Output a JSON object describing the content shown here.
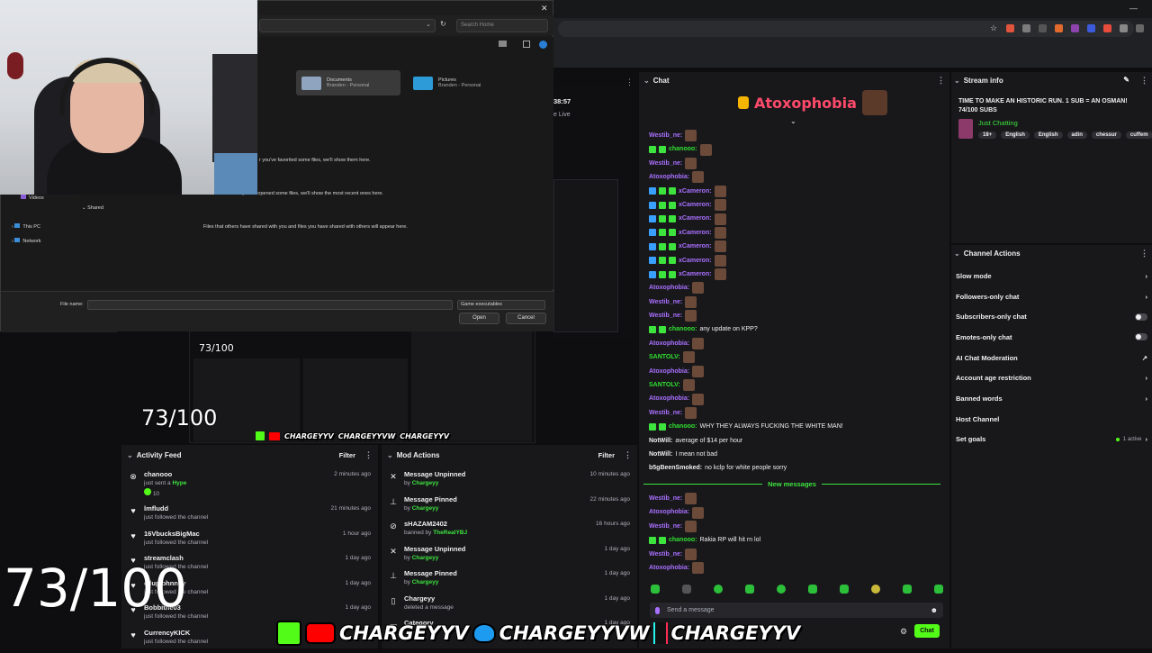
{
  "file_dialog": {
    "search_placeholder": "Search Home",
    "quick_access": [
      {
        "name": "Documents",
        "sub": "Branden - Personal"
      },
      {
        "name": "Pictures",
        "sub": "Branden - Personal"
      }
    ],
    "fav_msg": "r you've favorited some files, we'll show them here.",
    "recent_msg": "After you've opened some files, we'll show the most recent ones here.",
    "shared_msg": "Files that others have shared with you and files you have shared with others will appear here.",
    "shared_label": "Shared",
    "nav": [
      "Videos",
      "This PC",
      "Network"
    ],
    "file_name_label": "File name:",
    "file_type": "Game executables",
    "open": "Open",
    "cancel": "Cancel"
  },
  "stream_preview": {
    "time": "38:57",
    "status": "e Live"
  },
  "overlay": {
    "count_small": "73/100",
    "count_medium": "73/100",
    "count_large": "73/100",
    "socials": [
      "CHARGEYYV",
      "CHARGEYYVW",
      "CHARGEYYV"
    ]
  },
  "activity_feed": {
    "title": "Activity Feed",
    "filter": "Filter",
    "items": [
      {
        "name": "chanooo",
        "sub": "just sent a",
        "extra": "Hype",
        "amount": "10",
        "time": "2 minutes ago"
      },
      {
        "name": "lmfludd",
        "sub": "just followed the channel",
        "time": "21 minutes ago"
      },
      {
        "name": "16VbucksBigMac",
        "sub": "just followed the channel",
        "time": "1 hour ago"
      },
      {
        "name": "streamclash",
        "sub": "just followed the channel",
        "time": "1 day ago"
      },
      {
        "name": "ellupjohnnyy",
        "sub": "just followed the channel",
        "time": "1 day ago"
      },
      {
        "name": "Bobbithe03",
        "sub": "just followed the channel",
        "time": "1 day ago"
      },
      {
        "name": "CurrencyKICK",
        "sub": "just followed the channel",
        "time": ""
      }
    ]
  },
  "mod_actions": {
    "title": "Mod Actions",
    "filter": "Filter",
    "items": [
      {
        "title": "Message Unpinned",
        "by": "by",
        "user": "Chargeyy",
        "time": "10 minutes ago"
      },
      {
        "title": "Message Pinned",
        "by": "by",
        "user": "Chargeyy",
        "time": "22 minutes ago"
      },
      {
        "title": "sHAZAM2402",
        "by": "banned by",
        "user": "TheRealYBJ",
        "time": "16 hours ago"
      },
      {
        "title": "Message Unpinned",
        "by": "by",
        "user": "Chargeyy",
        "time": "1 day ago"
      },
      {
        "title": "Message Pinned",
        "by": "by",
        "user": "Chargeyy",
        "time": "1 day ago"
      },
      {
        "title": "Chargeyy",
        "by": "deleted a message",
        "user": "",
        "time": "1 day ago"
      },
      {
        "title": "Category",
        "by": "",
        "user": "",
        "time": "1 day ago"
      }
    ]
  },
  "chat": {
    "title": "Chat",
    "pinned_user": "Atoxophobia",
    "new_messages": "New messages",
    "input_placeholder": "Send a message",
    "send": "Chat",
    "lines": [
      {
        "user": "Westib_ne:",
        "color": "purple",
        "msg": ""
      },
      {
        "user": "chanooo:",
        "color": "green",
        "msg": ""
      },
      {
        "user": "Westib_ne:",
        "color": "purple",
        "msg": ""
      },
      {
        "user": "Atoxophobia:",
        "color": "purple",
        "msg": ""
      },
      {
        "user": "xCameron:",
        "color": "purple",
        "msg": ""
      },
      {
        "user": "xCameron:",
        "color": "purple",
        "msg": ""
      },
      {
        "user": "xCameron:",
        "color": "purple",
        "msg": ""
      },
      {
        "user": "xCameron:",
        "color": "purple",
        "msg": ""
      },
      {
        "user": "xCameron:",
        "color": "purple",
        "msg": ""
      },
      {
        "user": "xCameron:",
        "color": "purple",
        "msg": ""
      },
      {
        "user": "xCameron:",
        "color": "purple",
        "msg": ""
      },
      {
        "user": "Atoxophobia:",
        "color": "purple",
        "msg": ""
      },
      {
        "user": "Westib_ne:",
        "color": "purple",
        "msg": ""
      },
      {
        "user": "Westib_ne:",
        "color": "purple",
        "msg": ""
      },
      {
        "user": "chanooo:",
        "color": "green",
        "msg": "any update on KPP?"
      },
      {
        "user": "Atoxophobia:",
        "color": "purple",
        "msg": ""
      },
      {
        "user": "SANTOLV:",
        "color": "green",
        "msg": ""
      },
      {
        "user": "Atoxophobia:",
        "color": "purple",
        "msg": ""
      },
      {
        "user": "SANTOLV:",
        "color": "green",
        "msg": ""
      },
      {
        "user": "Atoxophobia:",
        "color": "purple",
        "msg": ""
      },
      {
        "user": "Westib_ne:",
        "color": "purple",
        "msg": ""
      },
      {
        "user": "chanooo:",
        "color": "green",
        "msg": "WHY THEY ALWAYS FUCKING THE WHITE MAN!"
      },
      {
        "user": "NotWill:",
        "color": "white",
        "msg": "average of $14 per hour"
      },
      {
        "user": "NotWill:",
        "color": "white",
        "msg": "I mean not bad"
      },
      {
        "user": "b5gBeenSmoked:",
        "color": "white",
        "msg": "no kclp for white people sorry"
      }
    ],
    "after_lines": [
      {
        "user": "Westib_ne:",
        "color": "purple",
        "msg": ""
      },
      {
        "user": "Atoxophobia:",
        "color": "purple",
        "msg": ""
      },
      {
        "user": "Westib_ne:",
        "color": "purple",
        "msg": ""
      },
      {
        "user": "chanooo:",
        "color": "green",
        "msg": "Rakia RP will hit rn lol"
      },
      {
        "user": "Westib_ne:",
        "color": "purple",
        "msg": ""
      },
      {
        "user": "Atoxophobia:",
        "color": "purple",
        "msg": ""
      }
    ]
  },
  "stream_info": {
    "title": "Stream info",
    "stream_title": "TIME TO MAKE AN HISTORIC RUN. 1 SUB = AN OSMAN! 74/100 SUBS",
    "category": "Just Chatting",
    "tags": [
      "18+",
      "English",
      "English",
      "adin",
      "chessur",
      "cuffem"
    ]
  },
  "channel_actions": {
    "title": "Channel Actions",
    "items": [
      {
        "label": "Slow mode",
        "control": "arrow"
      },
      {
        "label": "Followers-only chat",
        "control": "arrow"
      },
      {
        "label": "Subscribers-only chat",
        "control": "toggle"
      },
      {
        "label": "Emotes-only chat",
        "control": "toggle"
      },
      {
        "label": "AI Chat Moderation",
        "control": "external"
      },
      {
        "label": "Account age restriction",
        "control": "arrow"
      },
      {
        "label": "Banned words",
        "control": "arrow"
      },
      {
        "label": "Host Channel",
        "control": "none"
      },
      {
        "label": "Set goals",
        "control": "arrow",
        "status": "1 active"
      }
    ]
  },
  "colors": {
    "kick_green": "#53fc18",
    "twitch_purple": "#a970ff",
    "panel": "#18181b"
  }
}
